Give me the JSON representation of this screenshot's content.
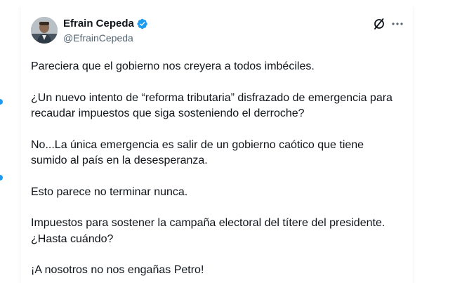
{
  "author": {
    "display_name": "Efrain Cepeda",
    "handle": "@EfrainCepeda",
    "verified": true,
    "avatar_icon": "profile-photo",
    "verified_icon": "verified-badge-icon"
  },
  "actions": {
    "grok_icon": "grok-icon",
    "more_icon": "more-options-icon"
  },
  "tweet": {
    "paragraphs": [
      {
        "lines": [
          "Pareciera que el gobierno nos creyera a todos imbéciles."
        ]
      },
      {
        "lines": [
          "¿Un nuevo intento de “reforma tributaria” disfrazado de emergencia para",
          "recaudar impuestos que siga sosteniendo el derroche?"
        ]
      },
      {
        "lines": [
          "No...La única emergencia es salir de un gobierno caótico que tiene",
          "sumido al país en la desesperanza."
        ]
      },
      {
        "lines": [
          "Esto parece no terminar nunca."
        ]
      },
      {
        "lines": [
          "Impuestos para sostener la campaña electoral del títere del presidente.",
          "¿Hasta cuándo?"
        ]
      },
      {
        "lines": [
          "¡A nosotros no nos engañas Petro!"
        ]
      }
    ]
  },
  "colors": {
    "verified": "#1d9bf0",
    "text_primary": "#0f1419",
    "text_secondary": "#536471",
    "border": "#eff3f4"
  }
}
